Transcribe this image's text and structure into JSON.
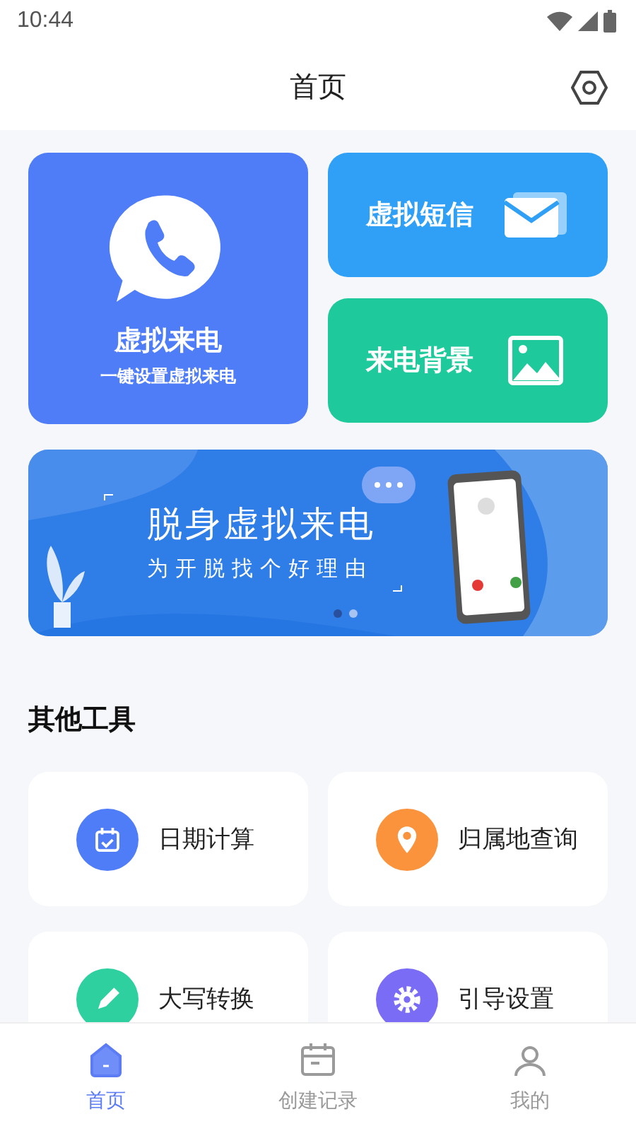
{
  "status_bar": {
    "time": "10:44"
  },
  "header": {
    "title": "首页"
  },
  "feature_cards": [
    {
      "kind": "call",
      "title": "虚拟来电",
      "subtitle": "一键设置虚拟来电",
      "color": "#4f7cf7"
    },
    {
      "kind": "sms",
      "title": "虚拟短信",
      "color": "#2fa0f5"
    },
    {
      "kind": "background",
      "title": "来电背景",
      "color": "#1ec99b"
    }
  ],
  "banner": {
    "title": "脱身虚拟来电",
    "subtitle": "为开脱找个好理由",
    "dots": [
      {
        "selected": true
      },
      {
        "selected": false
      }
    ]
  },
  "section_title": "其他工具",
  "tools": [
    {
      "kind": "calendar",
      "label": "日期计算",
      "color": "#4f7cf7"
    },
    {
      "kind": "pin",
      "label": "归属地查询",
      "color": "#fb923c"
    },
    {
      "kind": "pencil",
      "label": "大写转换",
      "color": "#2fd0a0"
    },
    {
      "kind": "gear",
      "label": "引导设置",
      "color": "#7b6cf6"
    }
  ],
  "tabs": [
    {
      "kind": "home",
      "label": "首页",
      "selected": true
    },
    {
      "kind": "record",
      "label": "创建记录",
      "selected": false
    },
    {
      "kind": "me",
      "label": "我的",
      "selected": false
    }
  ]
}
